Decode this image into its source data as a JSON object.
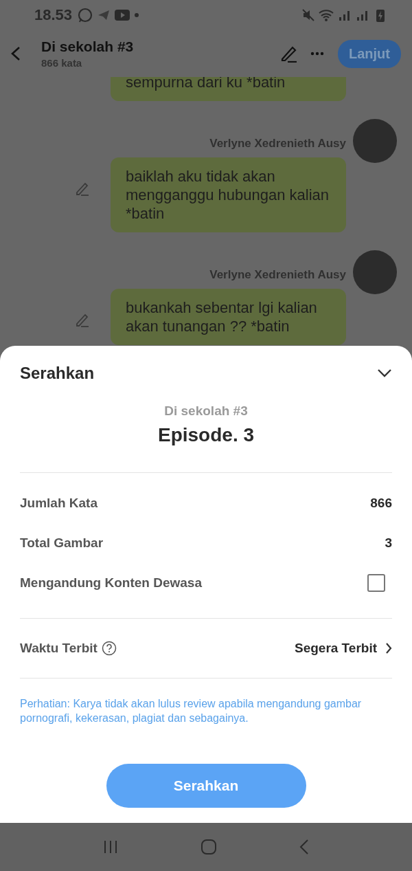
{
  "status_bar": {
    "time": "18.53"
  },
  "header": {
    "title": "Di sekolah #3",
    "subtitle": "866 kata",
    "next_button": "Lanjut"
  },
  "messages": [
    {
      "text": "sempurna dari ku *batin",
      "editable": false
    },
    {
      "author": "Verlyne Xedrenieth Ausy",
      "text": "baiklah aku tidak akan mengganggu hubungan kalian *batin",
      "editable": true
    },
    {
      "author": "Verlyne Xedrenieth Ausy",
      "text": "bukankah sebentar lgi kalian akan tunangan ?? *batin",
      "editable": true
    }
  ],
  "sheet": {
    "title": "Serahkan",
    "series": "Di sekolah #3",
    "episode": "Episode. 3",
    "stats": [
      {
        "label": "Jumlah Kata",
        "value": "866"
      },
      {
        "label": "Total Gambar",
        "value": "3"
      }
    ],
    "adult_content": {
      "label": "Mengandung Konten Dewasa",
      "checked": false
    },
    "publish_time": {
      "label": "Waktu Terbit",
      "value": "Segera Terbit"
    },
    "notice": "Perhatian: Karya tidak akan lulus review apabila mengandung gambar pornografi, kekerasan, plagiat dan sebagainya.",
    "submit_button": "Serahkan"
  }
}
